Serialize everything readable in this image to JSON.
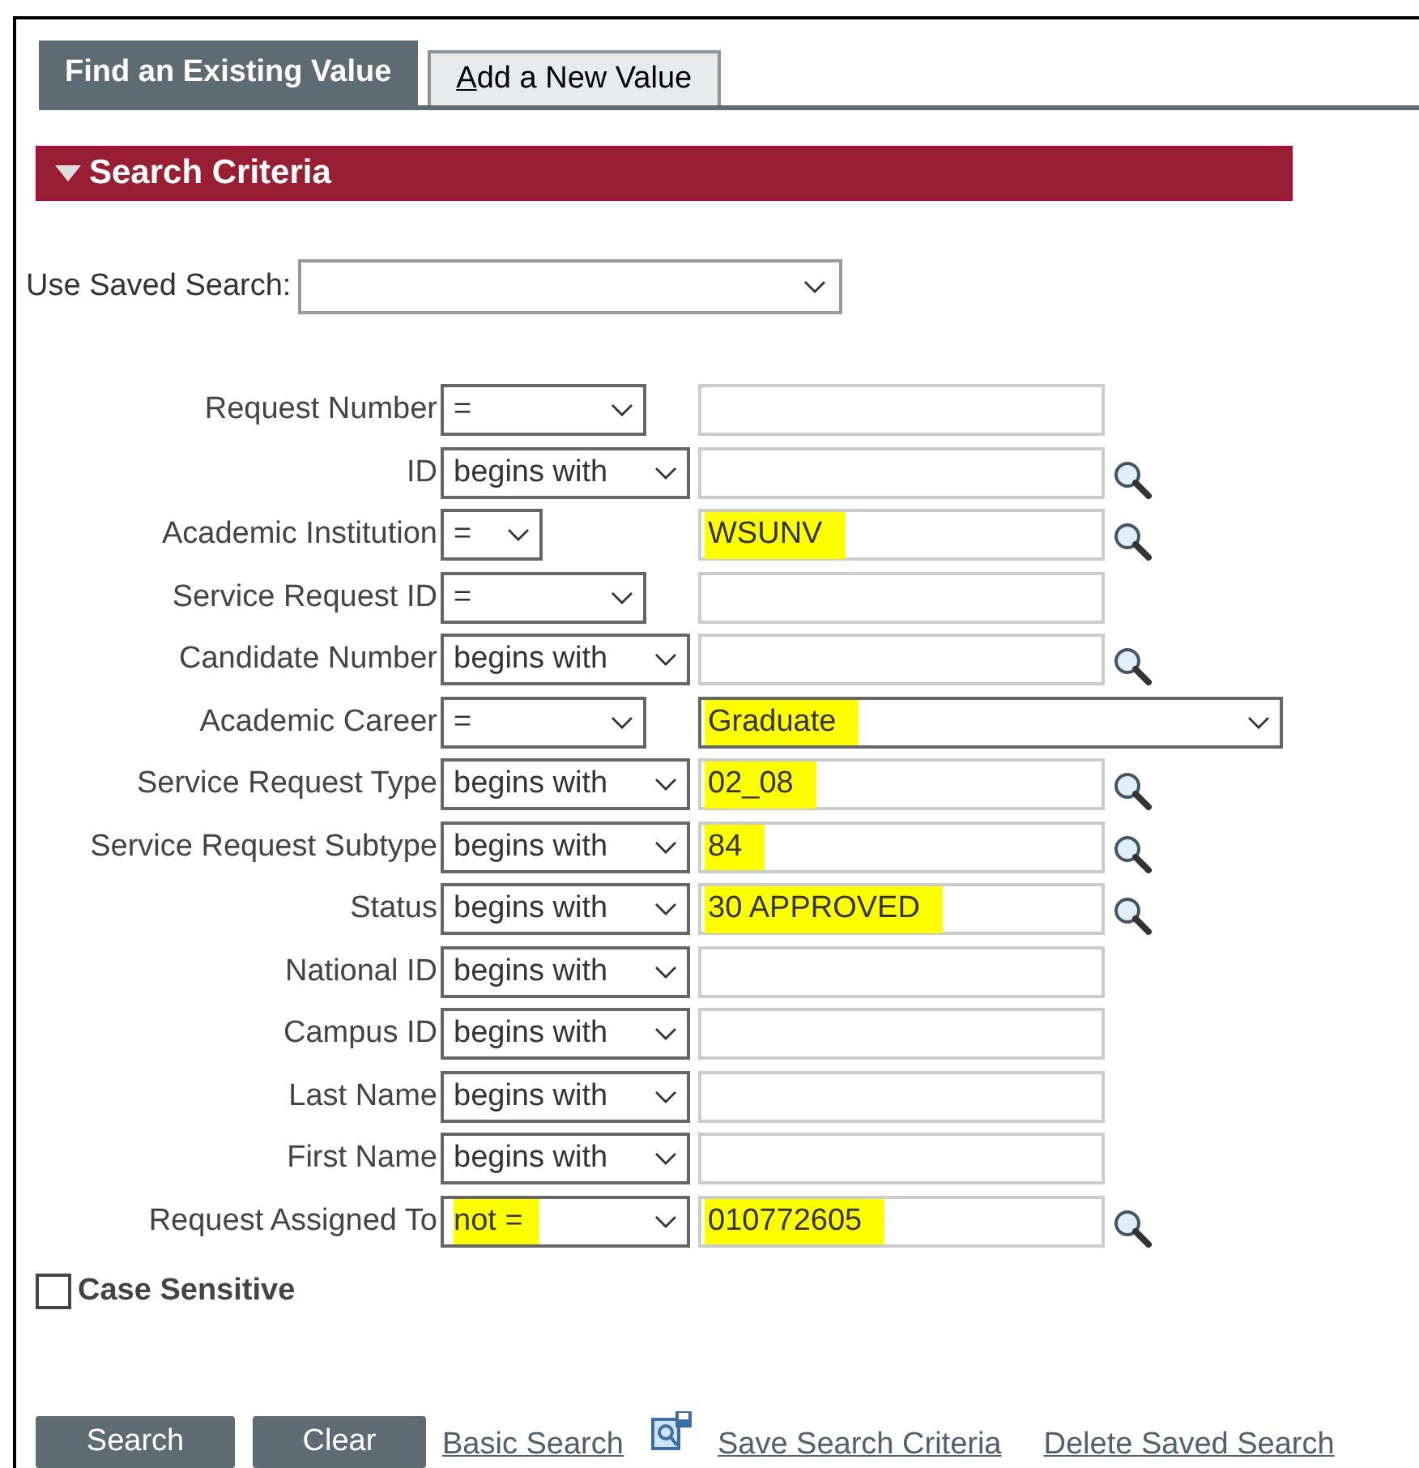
{
  "tabs": [
    {
      "label": "Find an Existing Value",
      "selected": true
    },
    {
      "label": "Add a New Value",
      "selected": false
    }
  ],
  "section": {
    "title": "Search Criteria",
    "expanded": true
  },
  "saved_search": {
    "label": "Use Saved Search:"
  },
  "rows": [
    {
      "label": "Request Number",
      "operator": {
        "text": "=",
        "kind": "medium"
      },
      "kind": "text"
    },
    {
      "label": "ID",
      "operator": {
        "text": "begins with",
        "kind": "long"
      },
      "kind": "lookup"
    },
    {
      "label": "Academic Institution",
      "operator": {
        "text": "=",
        "kind": "short"
      },
      "kind": "lookup",
      "value": "WSUNV",
      "highlighted": true
    },
    {
      "label": "Service Request ID",
      "operator": {
        "text": "=",
        "kind": "medium"
      },
      "kind": "text"
    },
    {
      "label": "Candidate Number",
      "operator": {
        "text": "begins with",
        "kind": "long"
      },
      "kind": "lookup"
    },
    {
      "label": "Academic Career",
      "operator": {
        "text": "=",
        "kind": "medium"
      },
      "kind": "select",
      "value": "Graduate",
      "highlighted": true
    },
    {
      "label": "Service Request Type",
      "operator": {
        "text": "begins with",
        "kind": "long"
      },
      "kind": "lookup",
      "value": "02_08",
      "highlighted": true
    },
    {
      "label": "Service Request Subtype",
      "operator": {
        "text": "begins with",
        "kind": "long"
      },
      "kind": "lookup",
      "value": "84",
      "highlighted": true
    },
    {
      "label": "Status",
      "operator": {
        "text": "begins with",
        "kind": "long"
      },
      "kind": "lookup",
      "value": "30 APPROVED",
      "highlighted": true
    },
    {
      "label": "National ID",
      "operator": {
        "text": "begins with",
        "kind": "long"
      },
      "kind": "text"
    },
    {
      "label": "Campus ID",
      "operator": {
        "text": "begins with",
        "kind": "long"
      },
      "kind": "text"
    },
    {
      "label": "Last Name",
      "operator": {
        "text": "begins with",
        "kind": "long"
      },
      "kind": "text"
    },
    {
      "label": "First Name",
      "operator": {
        "text": "begins with",
        "kind": "long"
      },
      "kind": "text"
    },
    {
      "label": "Request Assigned To",
      "operator": {
        "text": "not =",
        "kind": "long",
        "highlighted": true
      },
      "kind": "lookup",
      "value": "010772605",
      "highlighted": true
    }
  ],
  "case_sensitive": {
    "label": "Case Sensitive",
    "checked": false
  },
  "buttons": [
    {
      "label": "Search"
    },
    {
      "label": "Clear"
    }
  ],
  "links": [
    {
      "label": "Basic Search",
      "kind": "link"
    },
    {
      "label": "Save Search Criteria",
      "kind": "save"
    },
    {
      "label": "Delete Saved Search",
      "kind": "link"
    }
  ]
}
